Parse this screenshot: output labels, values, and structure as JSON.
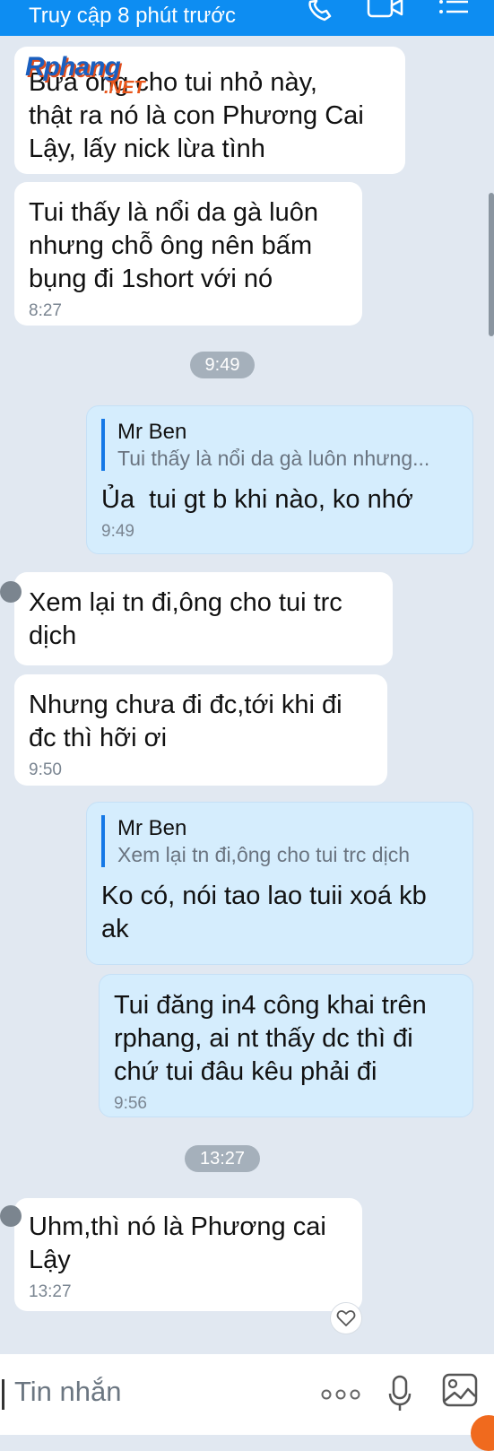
{
  "header": {
    "status": "Truy cập 8 phút trước",
    "icons": [
      "phone-icon",
      "video-call-icon",
      "menu-list-icon"
    ]
  },
  "watermark": {
    "brand": "Rphang",
    "suffix": ".NET"
  },
  "messages": [
    {
      "direction": "in",
      "text": "Bữa ông cho tui nhỏ này,\nthật ra nó là con Phương Cai\nLậy, lấy nick lừa tình"
    },
    {
      "direction": "in",
      "text": "Tui thấy là nổi da gà luôn\nnhưng chỗ ông nên bấm\nbụng đi 1short với nó",
      "time": "8:27"
    },
    {
      "direction": "out",
      "quote_name": "Mr Ben",
      "quote_text": "Tui thấy là nổi da gà luôn nhưng...",
      "text": "Ủa  tui gt b khi nào, ko nhớ",
      "time": "9:49"
    },
    {
      "direction": "in",
      "text": "Xem lại tn đi,ông cho tui trc\ndịch"
    },
    {
      "direction": "in",
      "text": "Nhưng chưa đi đc,tới khi đi\nđc thì hỡi ơi",
      "time": "9:50"
    },
    {
      "direction": "out",
      "quote_name": "Mr Ben",
      "quote_text": "Xem lại tn đi,ông cho tui trc dịch",
      "text": "Ko có, nói tao lao tuii xoá kb\nak"
    },
    {
      "direction": "out",
      "text": "Tui đăng in4 công khai trên\nrphang, ai nt thấy dc thì đi\nchứ tui đâu kêu phải đi",
      "time": "9:56"
    },
    {
      "direction": "in",
      "text": "Uhm,thì nó là Phương cai\nLậy",
      "time": "13:27"
    }
  ],
  "time_chips": [
    "9:49",
    "13:27"
  ],
  "input": {
    "placeholder": "Tin nhắn",
    "icons": [
      "more-dots-icon",
      "microphone-icon",
      "image-icon"
    ]
  },
  "colors": {
    "header": "#0d8df2",
    "background": "#e1e8f1",
    "incoming_bubble": "#ffffff",
    "outgoing_bubble": "#d5edfd",
    "quote_bar": "#1578e6",
    "time_chip": "#a5b0bb",
    "accent_orange": "#f06a1e"
  }
}
